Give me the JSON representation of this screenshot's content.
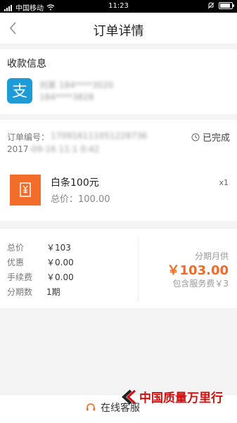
{
  "status_bar": {
    "carrier": "中国移动",
    "time": "11:23"
  },
  "navbar": {
    "title": "订单详情"
  },
  "payee": {
    "title": "收款信息",
    "line1": "刘某 184****3020",
    "line2": "184****3828"
  },
  "order": {
    "number_label": "订单编号：",
    "number_value": "170916111051228736",
    "date_prefix": "2017",
    "date_value": "-09-16 11:1 0:42",
    "status": "已完成"
  },
  "item": {
    "name": "白条100元",
    "price": "总价：100.00",
    "qty": "x1"
  },
  "summary": {
    "rows": [
      {
        "label": "总价",
        "value": "￥103"
      },
      {
        "label": "优惠",
        "value": "￥0.00"
      },
      {
        "label": "手续费",
        "value": "￥0.00"
      },
      {
        "label": "分期数",
        "value": "1期"
      }
    ],
    "installment_label": "分期月供",
    "installment_amount": "￥103.00",
    "installment_fee": "包含服务费￥3"
  },
  "footer": {
    "cs_label": "在线客服"
  },
  "watermark": {
    "text": "中国质量万里行"
  },
  "colors": {
    "accent": "#ef6b2a",
    "alipay_blue": "#1d9bd7",
    "watermark_red": "#d40f0f"
  }
}
